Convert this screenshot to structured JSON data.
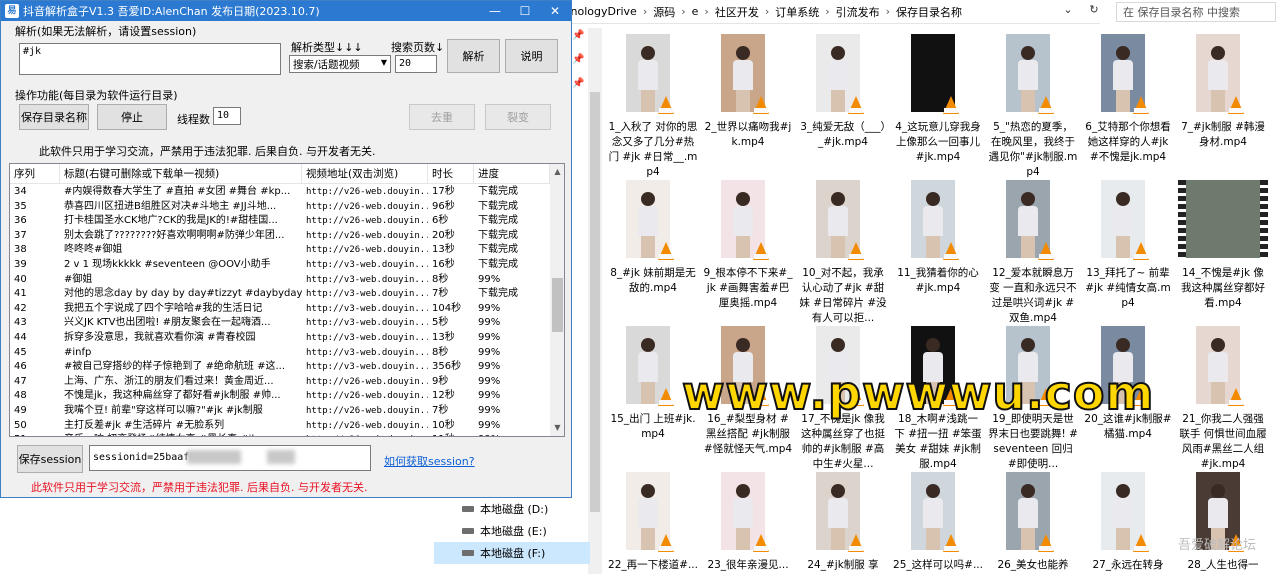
{
  "app": {
    "title": "抖音解析盒子V1.3    吾爱ID:AlenChan    发布日期(2023.10.7)",
    "icon_text": "易",
    "window_buttons": {
      "minimize": "—",
      "maximize": "☐",
      "close": "✕"
    },
    "parse_label": "解析(如果无法解析，请设置session)",
    "parse_input_value": "#jk",
    "parse_type_label": "解析类型↓↓↓",
    "parse_type_value": "搜索/话题视频",
    "page_count_label": "搜索页数↓",
    "page_count_value": "20",
    "parse_button": "解析",
    "help_button": "说明",
    "ops_label": "操作功能(每目录为软件运行目录)",
    "save_dir_button": "保存目录名称",
    "stop_button": "停止",
    "threads_label": "线程数",
    "threads_value": "10",
    "dedupe_button": "去重",
    "split_button": "裂变",
    "warning_top": "此软件只用于学习交流，严禁用于违法犯罪. 后果自负. 与开发者无关.",
    "table": {
      "columns": [
        "序列",
        "标题(右键可删除或下载单一视频)",
        "视频地址(双击浏览)",
        "时长",
        "进度"
      ],
      "rows": [
        [
          "34",
          "#内娱得数春大学生了 #直拍 #女团 #舞台 #kp...",
          "http://v26-web.douyin...",
          "17秒",
          "下载完成"
        ],
        [
          "35",
          "恭喜四川区扭进B组胜区对决#斗地主 #JJ斗地...",
          "http://v26-web.douyin...",
          "96秒",
          "下载完成"
        ],
        [
          "36",
          "打卡桂国圣水CK地广?CK的我是JK的!#甜桂国...",
          "http://v26-web.douyin...",
          "6秒",
          "下载完成"
        ],
        [
          "37",
          "别太会跳了????????好喜欢啊啊啊#防弹少年团...",
          "http://v26-web.douyin...",
          "20秒",
          "下载完成"
        ],
        [
          "38",
          "咚咚咚#御姐",
          "http://v26-web.douyin...",
          "13秒",
          "下载完成"
        ],
        [
          "39",
          "2 v 1 现场kkkkk #seventeen @OOV小助手",
          "http://v3-web.douyin...",
          "16秒",
          "下载完成"
        ],
        [
          "40",
          "#御姐",
          "http://v3-web.douyin...",
          "8秒",
          "99%"
        ],
        [
          "41",
          "对他的思念day by day by day#tizzyt #daybyday",
          "http://v3-web.douyin...",
          "7秒",
          "下载完成"
        ],
        [
          "42",
          "我把五个字说成了四个字哈哈#我的生活日记",
          "http://v3-web.douyin...",
          "104秒",
          "99%"
        ],
        [
          "43",
          "兴义JK KTV也出团啦! #朋友聚会在一起嗨酒...",
          "http://v3-web.douyin...",
          "5秒",
          "99%"
        ],
        [
          "44",
          "拆穿多没意思，我就喜欢看你演 #青春校园",
          "http://v3-web.douyin...",
          "13秒",
          "99%"
        ],
        [
          "45",
          "#infp",
          "http://v3-web.douyin...",
          "8秒",
          "99%"
        ],
        [
          "46",
          "#被自己穿搭纱的样子惊艳到了 #绝命航班 #这...",
          "http://v3-web.douyin...",
          "356秒",
          "99%"
        ],
        [
          "47",
          "上海、广东、浙江的朋友们看过来！黄金周近...",
          "http://v26-web.douyin...",
          "9秒",
          "99%"
        ],
        [
          "48",
          "不愧是jk，我这种扁丝穿了都好看#jk制服 #帅...",
          "http://v26-web.douyin...",
          "12秒",
          "99%"
        ],
        [
          "49",
          "我嘴个豆! 前辈\"穿这样可以嘛?\"#jk #jk制服",
          "http://v26-web.douyin...",
          "7秒",
          "99%"
        ],
        [
          "50",
          "主打反差#jk #生活碎片 #无脸系列",
          "http://v26-web.douyin...",
          "10秒",
          "99%"
        ],
        [
          "51",
          "音乐一响 初恋登场#纯情女高 #黑长直 #jk",
          "http://v26-web.douyin...",
          "11秒",
          "99%"
        ],
        [
          "52",
          "不愧是jk，我这种扁丝都能穿的好看#jk制服",
          "http://v26-web.douyin...",
          "13秒",
          "待下载"
        ]
      ]
    },
    "save_session_button": "保存session",
    "session_value": "sessionid=25baaf0",
    "help_link": "如何获取session?",
    "warning_bottom": "此软件只用于学习交流，严禁用于违法犯罪. 后果自负. 与开发者无关."
  },
  "explorer": {
    "breadcrumbs": [
      "ynologyDrive",
      "源码",
      "e",
      "社区开发",
      "订单系统",
      "引流发布",
      "保存目录名称"
    ],
    "search_placeholder": "在 保存目录名称 中搜索",
    "drives": [
      {
        "label": "本地磁盘 (D:)",
        "selected": false
      },
      {
        "label": "本地磁盘 (E:)",
        "selected": false
      },
      {
        "label": "本地磁盘 (F:)",
        "selected": true
      }
    ],
    "files": [
      "1_入秋了 对你的思念又多了几分#热门 #jk #日常__.mp4",
      "2_世界以痛吻我#jk.mp4",
      "3_纯爱无敌（___）_#jk.mp4",
      "4_这玩意儿穿我身上像那么一回事儿#jk.mp4",
      "5_\"热恋的夏季，在晚风里，我终于遇见你\"#jk制服.mp4",
      "6_艾特那个你想看她这样穿的人#jk #不愧是jk.mp4",
      "7_#jk制服 #韩漫身材.mp4",
      "8_#jk 妹前期是无敌的.mp4",
      "9_根本停不下来#_jk #画舞害羞#巴厘奥摇.mp4",
      "10_对不起，我承认心动了#jk #甜妹 #日常碎片 #没有人可以拒...",
      "11_我猜着你的心#jk.mp4",
      "12_爱本就瞬息万变 一直和永远只不过是哄兴词#jk #双鱼.mp4",
      "13_拜托了~ 前辈#jk #纯情女高.mp4",
      "14_不愧是#jk 像我这种属丝穿都好看.mp4",
      "15_出门 上班#jk.mp4",
      "16_#梨型身材 #黑丝搭配 #jk制服 #怪就怪天气.mp4",
      "17_不愧是jk 像我这种属丝穿了也挺帅的#jk制服 #高中生#火星...",
      "18_木啊#浅跳一下 #扭一扭 #笨蛋美女 #甜妹 #jk制服.mp4",
      "19_即使明天是世界末日也要跳舞! #seventeen 回归 #即使明...",
      "20_这谁#jk制服#橘猫.mp4",
      "21_你我二人强强联手 何惧世间血履风雨#黑丝二人组 #jk.mp4",
      "22_再一下楼道#...",
      "23_很年亲漫见...",
      "24_#jk制服 享呀...",
      "25_这样可以吗#...",
      "26_美女也能养养...",
      "27_永远在转身且...",
      "28_人生也得一个..."
    ]
  },
  "overlay": {
    "watermark": "www.pwwwu.com",
    "corner_watermark": "吾爱破解论坛"
  },
  "colors": {
    "titlebar": "#2b79d0",
    "warning_red": "#e81123",
    "link_blue": "#0b5ed7",
    "watermark_yellow": "#ffd600",
    "drive_selected": "#cce8ff"
  }
}
